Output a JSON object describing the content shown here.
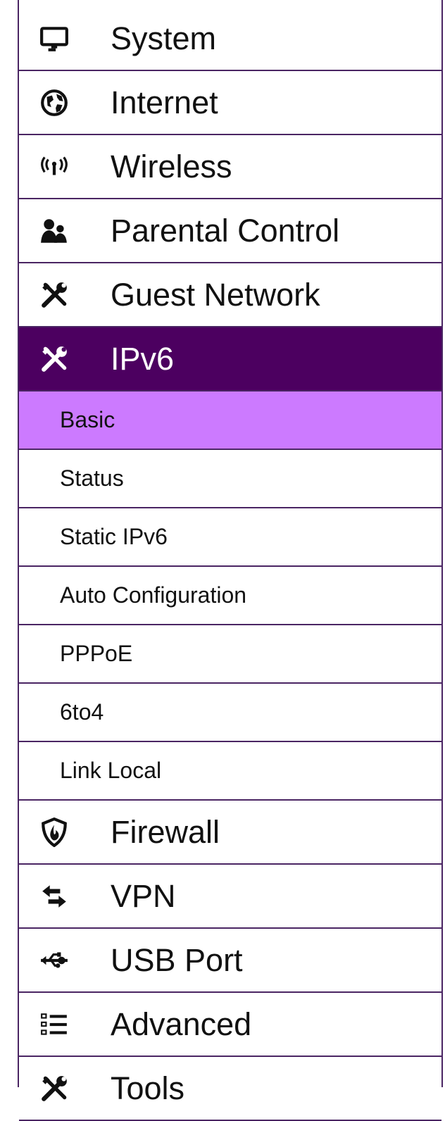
{
  "nav": {
    "items_before": [
      {
        "label": "System",
        "icon": "monitor-icon"
      },
      {
        "label": "Internet",
        "icon": "globe-icon"
      },
      {
        "label": "Wireless",
        "icon": "wireless-icon"
      },
      {
        "label": "Parental Control",
        "icon": "users-icon"
      },
      {
        "label": "Guest Network",
        "icon": "tools-icon"
      }
    ],
    "active_item": {
      "label": "IPv6",
      "icon": "tools-icon"
    },
    "sub_items": [
      {
        "label": "Basic",
        "selected": true
      },
      {
        "label": "Status"
      },
      {
        "label": "Static IPv6"
      },
      {
        "label": "Auto Configuration"
      },
      {
        "label": "PPPoE"
      },
      {
        "label": "6to4"
      },
      {
        "label": "Link Local"
      }
    ],
    "items_after": [
      {
        "label": "Firewall",
        "icon": "shield-icon"
      },
      {
        "label": "VPN",
        "icon": "exchange-arrows-icon"
      },
      {
        "label": "USB Port",
        "icon": "usb-icon"
      },
      {
        "label": "Advanced",
        "icon": "list-icon"
      },
      {
        "label": "Tools",
        "icon": "tools-icon"
      }
    ]
  },
  "colors": {
    "border": "#4a2563",
    "active_bg": "#4c0060",
    "selected_sub_bg": "#cc7aff",
    "text": "#111111",
    "active_text": "#ffffff"
  }
}
